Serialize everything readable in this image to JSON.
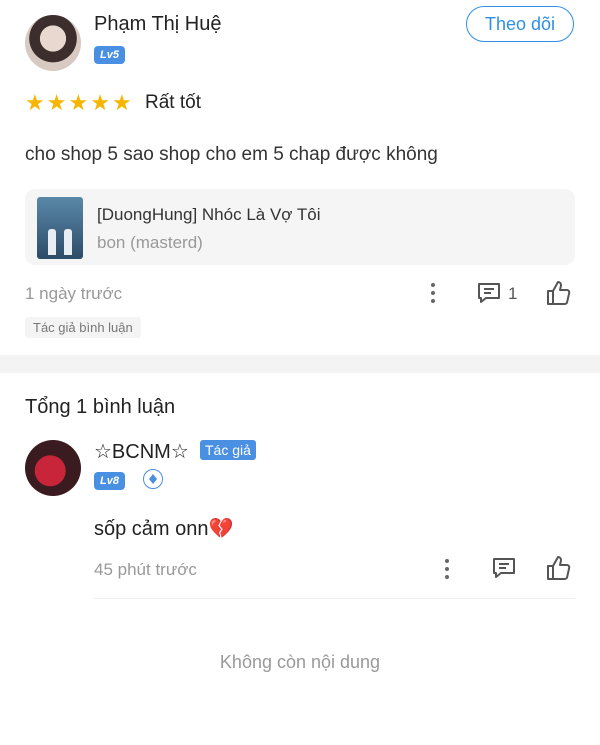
{
  "review": {
    "user_name": "Phạm Thị Huệ",
    "level": "Lv5",
    "follow_label": "Theo dõi",
    "stars": 5,
    "rating_text": "Rất tốt",
    "text": "cho shop 5 sao shop cho em 5 chap được không",
    "story": {
      "title": "[DuongHung] Nhóc Là Vợ Tôi",
      "author": "bon (masterd)"
    },
    "time": "1 ngày trước",
    "comment_count": "1",
    "author_tag": "Tác giả bình luận"
  },
  "replies": {
    "total_label": "Tổng 1 bình luận",
    "items": [
      {
        "user_name": "☆BCNM☆",
        "author_badge": "Tác giả",
        "level": "Lv8",
        "text": "sốp cảm onn",
        "emoji": "💔",
        "time": "45 phút trước"
      }
    ]
  },
  "footer": {
    "no_more": "Không còn nội dung"
  },
  "colors": {
    "accent": "#2f8fe6",
    "star": "#f7b500",
    "level_badge": "#4a90e2"
  }
}
